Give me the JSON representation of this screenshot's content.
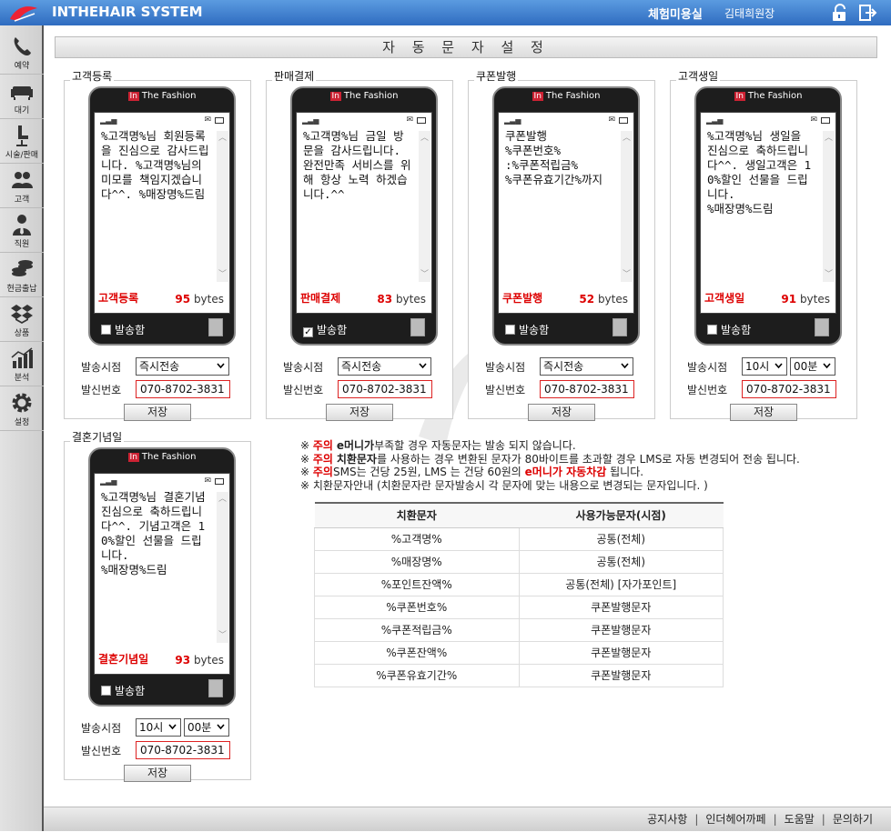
{
  "header": {
    "app_title": "INTHEHAIR SYSTEM",
    "shop_name": "체험미용실",
    "user_name": "김태희원장",
    "accent_color": "#3a79cc"
  },
  "sidebar": {
    "items": [
      {
        "label": "예약",
        "icon": "phone-icon"
      },
      {
        "label": "대기",
        "icon": "sofa-icon"
      },
      {
        "label": "시술/판매",
        "icon": "chair-icon"
      },
      {
        "label": "고객",
        "icon": "users-icon"
      },
      {
        "label": "직원",
        "icon": "staff-icon"
      },
      {
        "label": "현금출납",
        "icon": "coins-icon"
      },
      {
        "label": "상품",
        "icon": "box-icon"
      },
      {
        "label": "분석",
        "icon": "chart-icon"
      },
      {
        "label": "설정",
        "icon": "gear-icon"
      }
    ]
  },
  "page_title": "자 동 문 자 설 정",
  "phone_brand": "The Fashion",
  "phone_brand_mark": "In",
  "labels": {
    "send_check": "발송함",
    "send_time": "발송시점",
    "sender_number": "발신번호",
    "save": "저장",
    "bytes_unit": "bytes"
  },
  "sections": [
    {
      "title": "고객등록",
      "kind": "고객등록",
      "message": "%고객명%님 회원등록을 진심으로 감사드립니다. %고객명%님의 미모를 책임지겠습니다^^. %매장명%드림",
      "bytes": "95",
      "send_checked": false,
      "timing": "즉시전송",
      "sender": "070-8702-3831"
    },
    {
      "title": "판매결제",
      "kind": "판매결제",
      "message": "%고객명%님 금일 방문을 감사드립니다. 완전만족 서비스를 위해 항상 노력 하겠습니다.^^",
      "bytes": "83",
      "send_checked": true,
      "timing": "즉시전송",
      "sender": "070-8702-3831"
    },
    {
      "title": "쿠폰발행",
      "kind": "쿠폰발행",
      "message": "쿠폰발행\n%쿠폰번호%\n:%쿠폰적립금%\n%쿠폰유효기간%까지",
      "bytes": "52",
      "send_checked": false,
      "timing": "즉시전송",
      "sender": "070-8702-3831"
    },
    {
      "title": "고객생일",
      "kind": "고객생일",
      "message": "%고객명%님 생일을 진심으로 축하드립니다^^. 생일고객은 10%할인 선물을 드립니다.\n%매장명%드림",
      "bytes": "91",
      "send_checked": false,
      "timing_hour": "10시",
      "timing_min": "00분",
      "sender": "070-8702-3831"
    },
    {
      "title": "결혼기념일",
      "kind": "결혼기념일",
      "message": "%고객명%님 결혼기념 진심으로 축하드립니다^^. 기념고객은 10%할인 선물을 드립니다.\n%매장명%드림",
      "bytes": "93",
      "send_checked": false,
      "timing_hour": "10시",
      "timing_min": "00분",
      "sender": "070-8702-3831"
    }
  ],
  "notes": {
    "mark": "※",
    "n1_a": "주의",
    "n1_b": "e머니가",
    "n1_c": "부족할 경우 자동문자는 발송 되지 않습니다.",
    "n2_a": "주의",
    "n2_b": "치환문자",
    "n2_c": "를 사용하는 경우 변환된 문자가 80바이트를 초과할 경우 LMS로 자동 변경되어 전송 됩니다.",
    "n3_a": "주의",
    "n3_b": "SMS는 건당 25원, LMS 는 건당 60원의",
    "n3_c": "e머니가 자동차감",
    "n3_d": "됩니다.",
    "n4": "치환문자안내 (치환문자란 문자발송시 각 문자에 맞는 내용으로 변경되는 문자입니다. )"
  },
  "table": {
    "headers": [
      "치환문자",
      "사용가능문자(시점)"
    ],
    "rows": [
      [
        "%고객명%",
        "공통(전체)"
      ],
      [
        "%매장명%",
        "공통(전체)"
      ],
      [
        "%포인트잔액%",
        "공통(전체) [자가포인트]"
      ],
      [
        "%쿠폰번호%",
        "쿠폰발행문자"
      ],
      [
        "%쿠폰적립금%",
        "쿠폰발행문자"
      ],
      [
        "%쿠폰잔액%",
        "쿠폰발행문자"
      ],
      [
        "%쿠폰유효기간%",
        "쿠폰발행문자"
      ]
    ]
  },
  "footer": {
    "links": [
      "공지사항",
      "인더헤어까페",
      "도움말",
      "문의하기"
    ],
    "separator": "|"
  }
}
